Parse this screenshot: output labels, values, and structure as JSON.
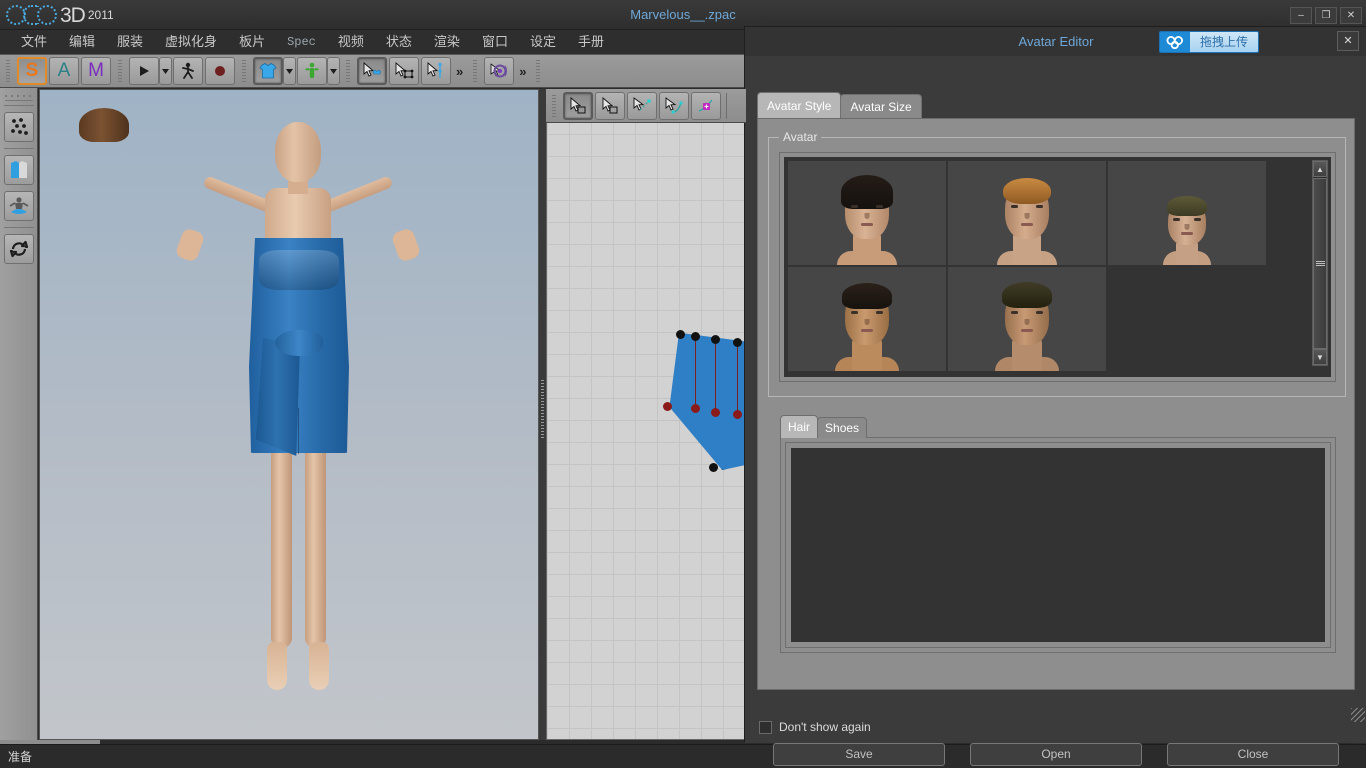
{
  "app": {
    "logo_text": "3D",
    "logo_year": "2011",
    "window_title": "Marvelous__.zpac",
    "window_buttons": [
      {
        "name": "minimize",
        "glyph": "–"
      },
      {
        "name": "restore",
        "glyph": "❐"
      },
      {
        "name": "close",
        "glyph": "✕"
      }
    ]
  },
  "menubar": {
    "items": [
      {
        "label": "文件"
      },
      {
        "label": "编辑"
      },
      {
        "label": "服装"
      },
      {
        "label": "虚拟化身"
      },
      {
        "label": "板片"
      },
      {
        "label": "Spec"
      },
      {
        "label": "视频"
      },
      {
        "label": "状态"
      },
      {
        "label": "渲染"
      },
      {
        "label": "窗口"
      },
      {
        "label": "设定"
      },
      {
        "label": "手册"
      }
    ]
  },
  "toolbar": {
    "mode_buttons": [
      {
        "name": "simulation-mode",
        "label": "S",
        "active": true
      },
      {
        "name": "animation-mode",
        "label": "A",
        "active": false
      },
      {
        "name": "modular-mode",
        "label": "M",
        "active": false
      }
    ],
    "playback": [
      {
        "name": "play-button",
        "glyph": "▶"
      },
      {
        "name": "walk-button",
        "glyph": "Ὣ6"
      },
      {
        "name": "record-button",
        "glyph": "●"
      }
    ],
    "chevron": "»"
  },
  "left_toolbar": {
    "items": [
      {
        "name": "particle-distance-tool"
      },
      {
        "name": "garment-color-tool"
      },
      {
        "name": "avatar-tool"
      },
      {
        "name": "sync-tool"
      }
    ]
  },
  "viewport": {
    "name": "3d-garment-viewport",
    "background_color": "#aab6c2"
  },
  "pattern_window": {
    "name": "2d-pattern-window",
    "piece_color": "#2f7fc6"
  },
  "statusbar": {
    "text": "准备"
  },
  "dialog": {
    "title": "Avatar Editor",
    "upload_button": {
      "label": "拖拽上传",
      "icon": "cloud-icon",
      "accent": "#1e8ad6"
    },
    "close_glyph": "✕",
    "tabs": [
      {
        "label": "Avatar Style",
        "active": true
      },
      {
        "label": "Avatar Size",
        "active": false
      }
    ],
    "group_legend": "Avatar",
    "avatars": [
      {
        "name": "avatar-asian-female",
        "skin": "#d9b394",
        "hair": "#15110e",
        "hair_style": "bob"
      },
      {
        "name": "avatar-western-female",
        "skin": "#d5ac8c",
        "hair": "#b5712e",
        "hair_style": "short"
      },
      {
        "name": "avatar-child",
        "skin": "#d7b194",
        "hair": "#4e4a2c",
        "hair_style": "crop"
      },
      {
        "name": "avatar-asian-male",
        "skin": "#c99a6e",
        "hair": "#17120e",
        "hair_style": "crop"
      },
      {
        "name": "avatar-western-male",
        "skin": "#c89a74",
        "hair": "#2e2b1d",
        "hair_style": "crop"
      }
    ],
    "scrollbar": {
      "up_glyph": "▲",
      "down_glyph": "▼"
    },
    "sub_tabs": [
      {
        "label": "Hair",
        "active": true
      },
      {
        "label": "Shoes",
        "active": false
      }
    ],
    "dont_show_again": {
      "label": "Don't show again",
      "checked": false
    },
    "buttons": [
      {
        "name": "save-button",
        "label": "Save"
      },
      {
        "name": "open-button",
        "label": "Open"
      },
      {
        "name": "close-button",
        "label": "Close"
      }
    ]
  }
}
